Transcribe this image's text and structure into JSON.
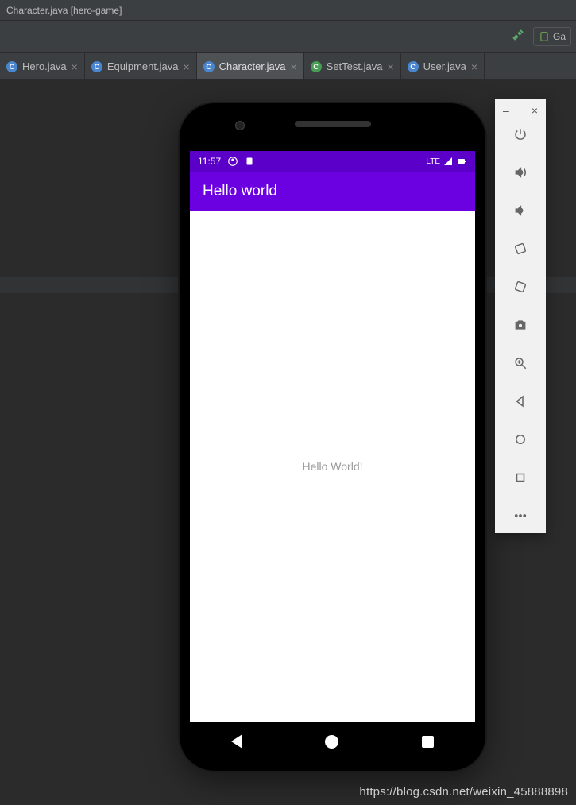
{
  "window": {
    "title": "Character.java [hero-game]"
  },
  "toolbar": {
    "config_label": "Ga"
  },
  "tabs": [
    {
      "label": "Hero.java",
      "icon": "blue",
      "active": false
    },
    {
      "label": "Equipment.java",
      "icon": "blue",
      "active": false
    },
    {
      "label": "Character.java",
      "icon": "blue",
      "active": true
    },
    {
      "label": "SetTest.java",
      "icon": "green",
      "active": false
    },
    {
      "label": "User.java",
      "icon": "blue",
      "active": false
    }
  ],
  "emulator": {
    "status_time": "11:57",
    "status_network_label": "LTE",
    "app_title": "Hello world",
    "body_text": "Hello World!",
    "sidebar_icons": [
      "power",
      "volume-up",
      "volume-down",
      "rotate-left",
      "rotate-right",
      "camera",
      "zoom-in",
      "back",
      "circle",
      "square",
      "more"
    ]
  },
  "watermark": "https://blog.csdn.net/weixin_45888898"
}
